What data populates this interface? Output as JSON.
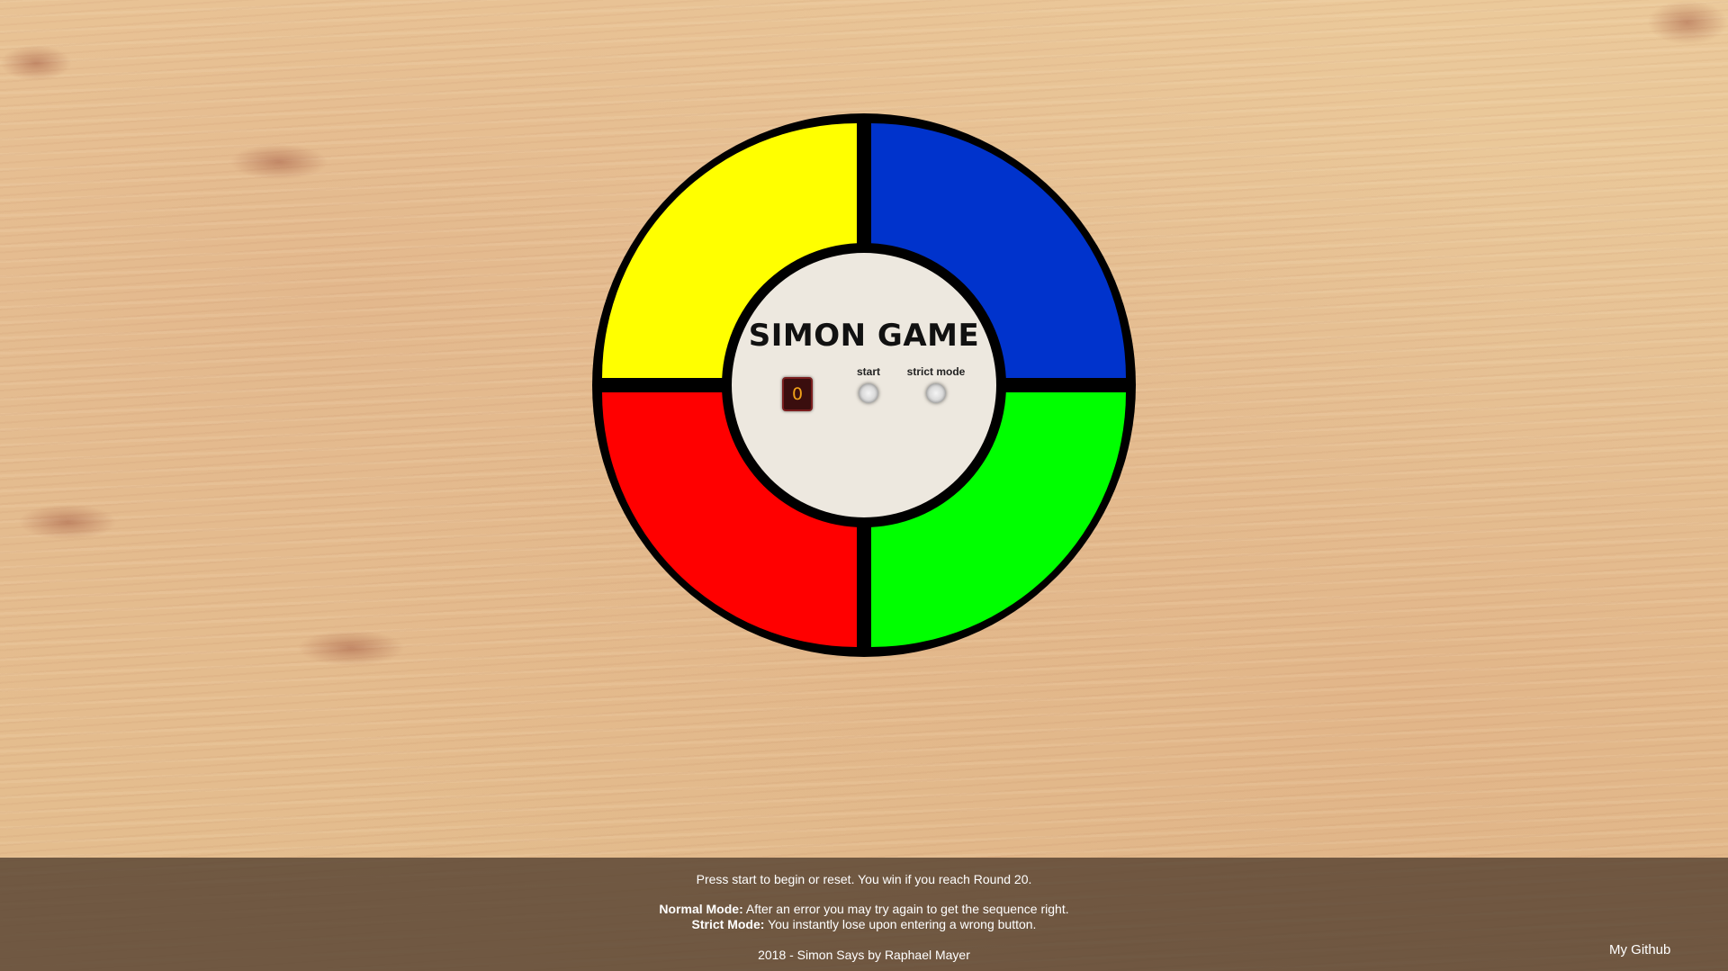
{
  "game": {
    "title": "SIMON GAME",
    "counter": "0",
    "start_label": "start",
    "strict_label": "strict mode",
    "pads": {
      "yellow": "#ffff00",
      "blue": "#0033cc",
      "red": "#ff0000",
      "green": "#00ff00"
    }
  },
  "footer": {
    "intro": "Press start to begin or reset. You win if you reach Round 20.",
    "normal_label": "Normal Mode:",
    "normal_text": " After an error you may try again to get the sequence right.",
    "strict_label": "Strict Mode:",
    "strict_text": " You instantly lose upon entering a wrong button.",
    "credit": "2018 - Simon Says by Raphael Mayer",
    "github": "My Github"
  }
}
